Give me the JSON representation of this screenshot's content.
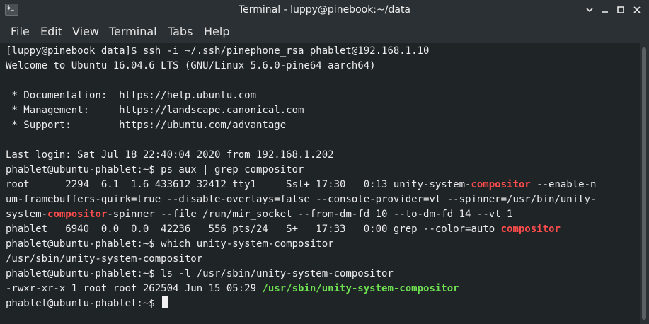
{
  "window": {
    "title": "Terminal - luppy@pinebook:~/data",
    "icon_text": "$_"
  },
  "menu": [
    {
      "label": "File"
    },
    {
      "label": "Edit"
    },
    {
      "label": "View"
    },
    {
      "label": "Terminal"
    },
    {
      "label": "Tabs"
    },
    {
      "label": "Help"
    }
  ],
  "terminal": {
    "lines": [
      {
        "segments": [
          {
            "text": "[luppy@pinebook data]$ ssh -i ~/.ssh/pinephone_rsa phablet@192.168.1.10"
          }
        ]
      },
      {
        "segments": [
          {
            "text": "Welcome to Ubuntu 16.04.6 LTS (GNU/Linux 5.6.0-pine64 aarch64)"
          }
        ]
      },
      {
        "segments": [
          {
            "text": ""
          }
        ]
      },
      {
        "segments": [
          {
            "text": " * Documentation:  https://help.ubuntu.com"
          }
        ]
      },
      {
        "segments": [
          {
            "text": " * Management:     https://landscape.canonical.com"
          }
        ]
      },
      {
        "segments": [
          {
            "text": " * Support:        https://ubuntu.com/advantage"
          }
        ]
      },
      {
        "segments": [
          {
            "text": ""
          }
        ]
      },
      {
        "segments": [
          {
            "text": "Last login: Sat Jul 18 22:40:04 2020 from 192.168.1.202"
          }
        ]
      },
      {
        "segments": [
          {
            "text": "phablet@ubuntu-phablet:~$ ps aux | grep compositor"
          }
        ]
      },
      {
        "segments": [
          {
            "text": "root      2294  6.1  1.6 433612 32412 tty1     Ssl+ 17:30   0:13 unity-system-"
          },
          {
            "text": "compositor",
            "style": "red"
          },
          {
            "text": " --enable-n"
          }
        ]
      },
      {
        "segments": [
          {
            "text": "um-framebuffers-quirk=true --disable-overlays=false --console-provider=vt --spinner=/usr/bin/unity-"
          }
        ]
      },
      {
        "segments": [
          {
            "text": "system-"
          },
          {
            "text": "compositor",
            "style": "red"
          },
          {
            "text": "-spinner --file /run/mir_socket --from-dm-fd 10 --to-dm-fd 14 --vt 1"
          }
        ]
      },
      {
        "segments": [
          {
            "text": "phablet   6940  0.0  0.0  42236   556 pts/24   S+   17:33   0:00 grep --color=auto "
          },
          {
            "text": "compositor",
            "style": "red"
          }
        ]
      },
      {
        "segments": [
          {
            "text": "phablet@ubuntu-phablet:~$ which unity-system-compositor"
          }
        ]
      },
      {
        "segments": [
          {
            "text": "/usr/sbin/unity-system-compositor"
          }
        ]
      },
      {
        "segments": [
          {
            "text": "phablet@ubuntu-phablet:~$ ls -l /usr/sbin/unity-system-compositor"
          }
        ]
      },
      {
        "segments": [
          {
            "text": "-rwxr-xr-x 1 root root 262504 Jun 15 05:29 "
          },
          {
            "text": "/usr/sbin/unity-system-compositor",
            "style": "green"
          }
        ]
      },
      {
        "segments": [
          {
            "text": "phablet@ubuntu-phablet:~$ "
          }
        ],
        "cursor": true
      }
    ]
  },
  "colors": {
    "background": "#1f2427",
    "foreground": "#ececec",
    "match_red": "#ff4c4c",
    "executable_green": "#6fe052"
  }
}
